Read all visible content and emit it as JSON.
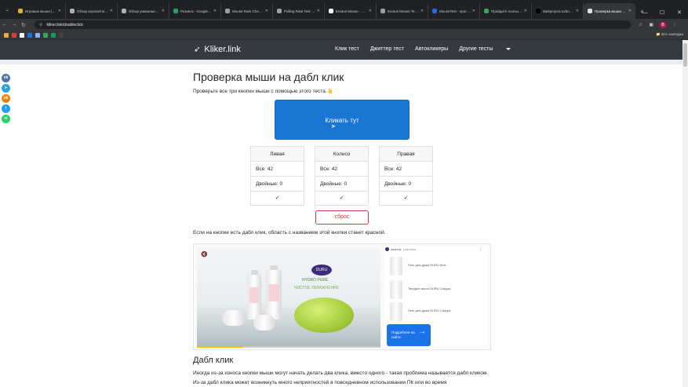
{
  "browser": {
    "tabs": [
      {
        "label": "Игровые мыши | Ob",
        "color": "#e8a93a"
      },
      {
        "label": "Обзор игровой мыш",
        "color": "#b0b0b0"
      },
      {
        "label": "Обзор уникальной м",
        "color": "#b0b0b0"
      },
      {
        "label": "Розинск - Google Таб",
        "color": "#23a566"
      },
      {
        "label": "Mouse Rate Checker",
        "color": "#9aa0a6"
      },
      {
        "label": "Polling Rate Test - Ch",
        "color": "#9aa0a6"
      },
      {
        "label": "Enotus Mouse - Поис",
        "color": "#ffffff"
      },
      {
        "label": "Enotus Mouse Test 0.",
        "color": "#9aa0a6"
      },
      {
        "label": "MouseTest - програм",
        "color": "#1a73e8"
      },
      {
        "label": "Пройдите полный т",
        "color": "#34a853"
      },
      {
        "label": "darkproject.ru/downl",
        "color": "#000000"
      },
      {
        "label": "Проверка мыши на д",
        "color": "#e0e0e0"
      }
    ],
    "url": "kliker.link/doubleclick",
    "all_bookmarks": "Все закладки",
    "profile_initial": "B"
  },
  "site": {
    "logo": "Kliker.link",
    "nav": [
      "Клик тест",
      "Джиттер тест",
      "Автокликеры",
      "Другие тесты"
    ]
  },
  "share": [
    {
      "name": "vk",
      "label": "vk",
      "color": "#4a76a8"
    },
    {
      "name": "telegram",
      "label": "➤",
      "color": "#2aa3df"
    },
    {
      "name": "odnoklassniki",
      "label": "ok",
      "color": "#ee8208"
    },
    {
      "name": "twitter",
      "label": "t",
      "color": "#1da1f2"
    },
    {
      "name": "whatsapp",
      "label": "w",
      "color": "#25d366"
    }
  ],
  "page": {
    "title": "Проверка мыши на дабл клик",
    "subtitle": "Проверьте все три кнопки мыши с помощью этого теста.👆",
    "click_button": "Кликать тут",
    "buttons": [
      {
        "name": "Левая",
        "all": "Все: 42",
        "double": "Двойные: 0",
        "check": "✓"
      },
      {
        "name": "Колесо",
        "all": "Все: 42",
        "double": "Двойные: 0",
        "check": "✓"
      },
      {
        "name": "Правая",
        "all": "Все: 42",
        "double": "Двойные: 0",
        "check": "✓"
      }
    ],
    "reset": "сброс",
    "info": "Если на кнопке есть дабл клик, область с названием этой кнопки станет красной.",
    "section_title": "Дабл клик",
    "paragraph": "Иногда из-за износа кнопки мыши могут начать делать два клика, вместо одного - такая проблема называется дабл кликом. Из-за дабл клика может возникнуть много неприятностей в повседневном использовании ПК или во время"
  },
  "ad": {
    "brand": "DURU",
    "line1": "HYDRO PURE",
    "line2": "ЧИСТОЕ УВЛАЖНЕНИЕ",
    "source": "ozon.ru",
    "source_tag": "реклама",
    "products": [
      "Гель для душа DURU Aloe",
      "Твердое мыло DURU Сакура",
      "Гель для душа DURU Сакура"
    ],
    "more_button": "Подробнее на сайте",
    "progress": 0.25
  }
}
